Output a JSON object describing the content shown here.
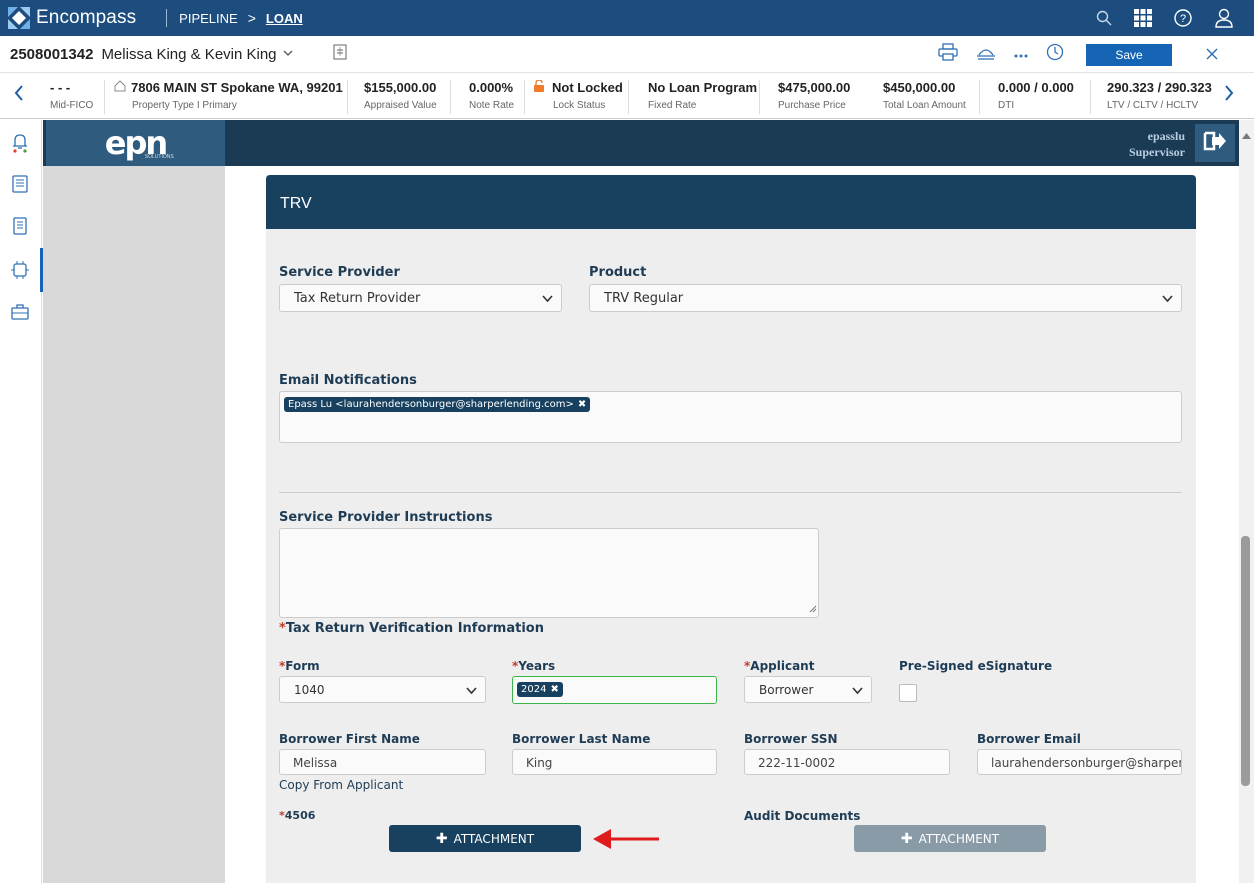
{
  "topbar": {
    "app_name": "Encompass",
    "crumb_pipeline": "PIPELINE",
    "crumb_sep": ">",
    "crumb_loan": "LOAN"
  },
  "loan_header": {
    "loan_number": "2508001342",
    "borrowers": "Melissa King & Kevin King",
    "save_label": "Save"
  },
  "summary": [
    {
      "value": "- - -",
      "label": "Mid-FICO"
    },
    {
      "value": "7806 MAIN ST Spokane WA, 99201",
      "label": "Property Type I Primary"
    },
    {
      "value": "$155,000.00",
      "label": "Appraised Value"
    },
    {
      "value": "0.000%",
      "label": "Note Rate"
    },
    {
      "value": "Not Locked",
      "label": "Lock Status"
    },
    {
      "value": "No Loan Program",
      "label": "Fixed Rate"
    },
    {
      "value": "$475,000.00",
      "label": "Purchase Price"
    },
    {
      "value": "$450,000.00",
      "label": "Total Loan Amount"
    },
    {
      "value": "0.000 / 0.000",
      "label": "DTI"
    },
    {
      "value": "290.323 / 290.323",
      "label": "LTV / CLTV / HCLTV"
    }
  ],
  "epn": {
    "logo": "epn",
    "logo_sub": "SOLUTIONS",
    "username": "epasslu",
    "role": "Supervisor"
  },
  "form": {
    "title": "TRV",
    "service_provider_label": "Service Provider",
    "service_provider_value": "Tax Return Provider",
    "product_label": "Product",
    "product_value": "TRV Regular",
    "email_label": "Email Notifications",
    "email_tag": "Epass Lu <laurahendersonburger@sharperlending.com>",
    "instructions_label": "Service Provider Instructions",
    "trv_info_label": "Tax Return Verification Information",
    "form_label": "Form",
    "form_value": "1040",
    "years_label": "Years",
    "years_tag": "2024",
    "applicant_label": "Applicant",
    "applicant_value": "Borrower",
    "presigned_label": "Pre-Signed eSignature",
    "first_name_label": "Borrower First Name",
    "first_name_value": "Melissa",
    "last_name_label": "Borrower Last Name",
    "last_name_value": "King",
    "ssn_label": "Borrower SSN",
    "ssn_value": "222-11-0002",
    "email_field_label": "Borrower Email",
    "email_field_value": "laurahendersonburger@sharperlending.com",
    "copy_link": "Copy From Applicant",
    "f4506_label": "4506",
    "audit_label": "Audit Documents",
    "attachment_label": "ATTACHMENT",
    "required_mark": "*"
  },
  "colors": {
    "topbar": "#1d4d7e",
    "panel_header": "#17415f",
    "attachment_active": "#17415f",
    "attachment_disabled": "#8a9ba8",
    "arrow": "#e01b1b",
    "save": "#1565b4"
  }
}
